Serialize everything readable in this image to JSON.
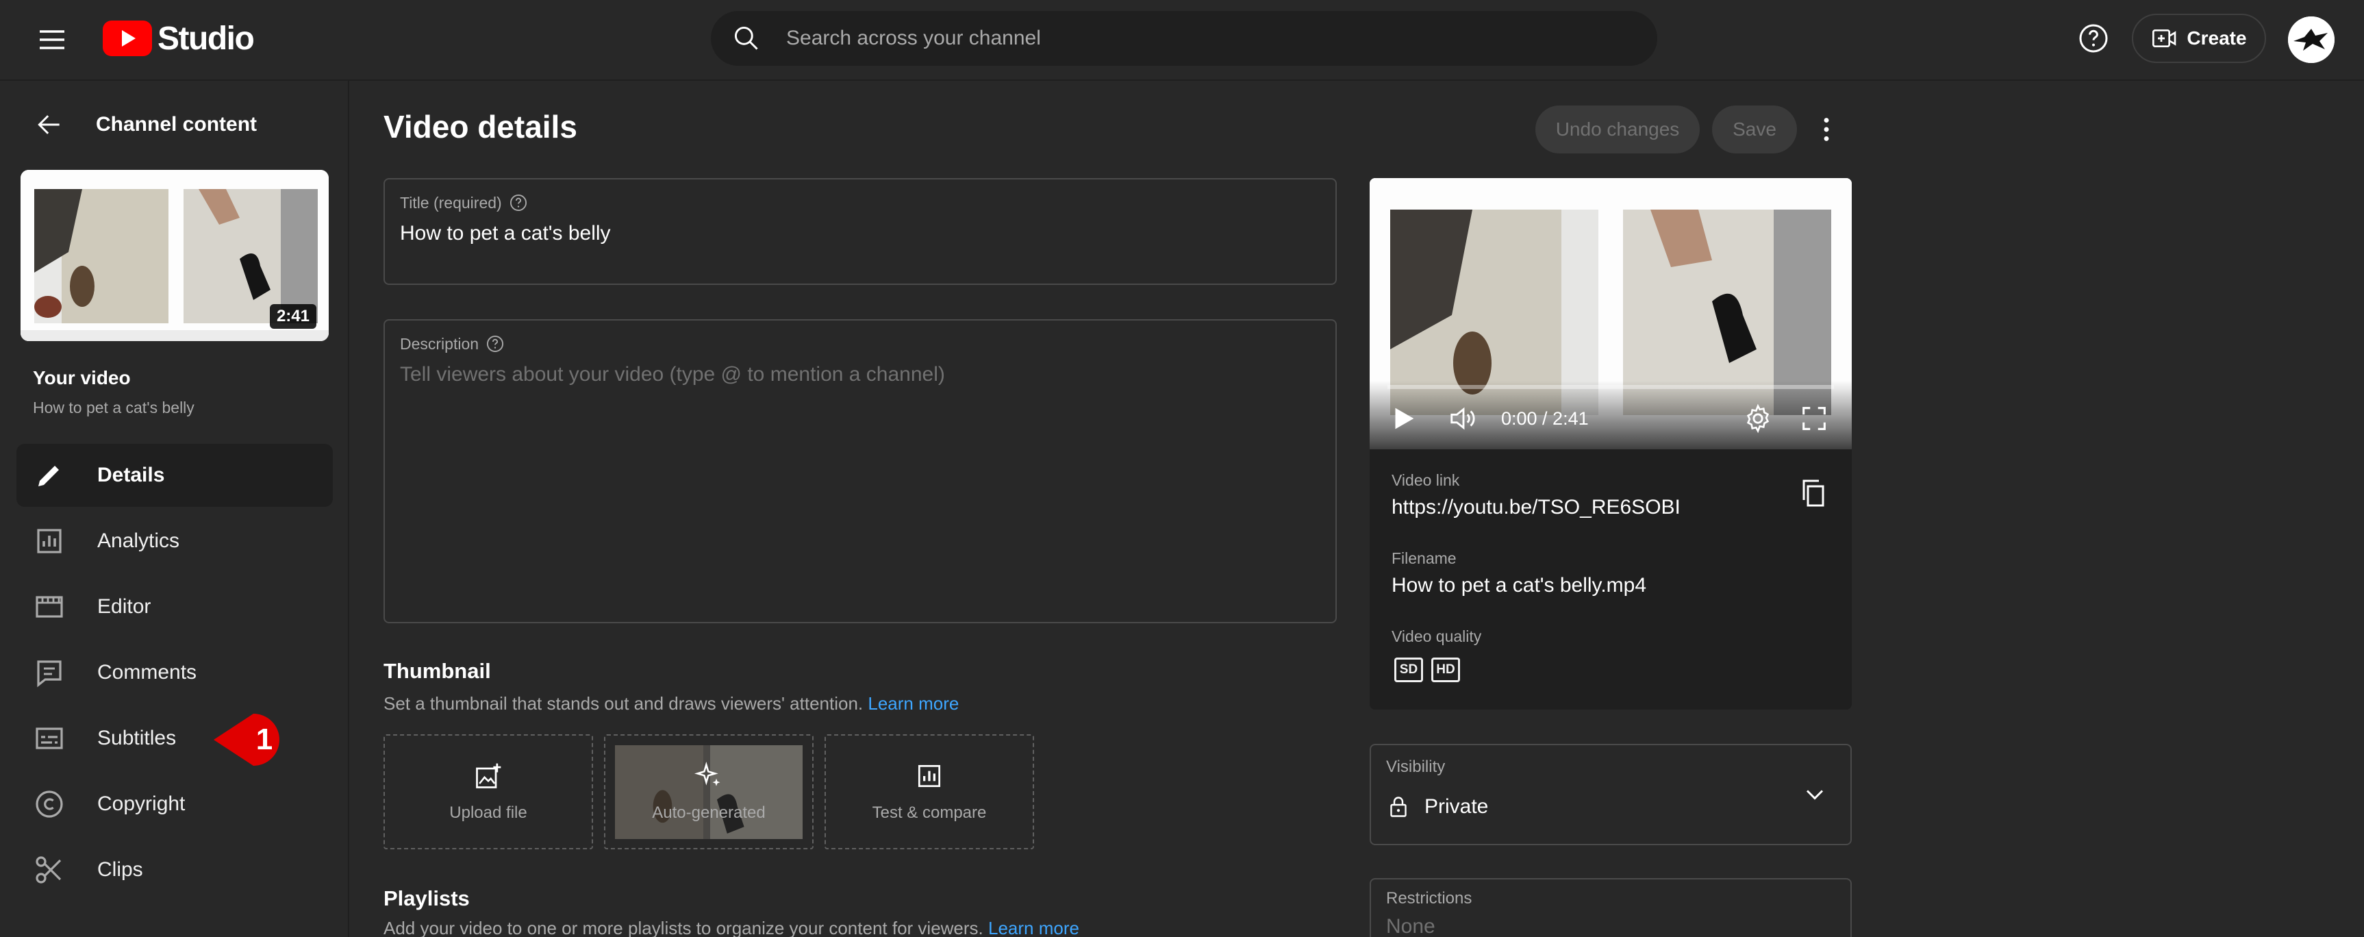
{
  "header": {
    "logo_text": "Studio",
    "search_placeholder": "Search across your channel",
    "create_label": "Create"
  },
  "sidebar": {
    "back_title": "Channel content",
    "thumb_duration": "2:41",
    "your_video_label": "Your video",
    "your_video_title": "How to pet a cat's belly",
    "items": [
      {
        "label": "Details",
        "icon": "pencil-icon",
        "active": true
      },
      {
        "label": "Analytics",
        "icon": "analytics-icon"
      },
      {
        "label": "Editor",
        "icon": "editor-icon"
      },
      {
        "label": "Comments",
        "icon": "comments-icon"
      },
      {
        "label": "Subtitles",
        "icon": "subtitles-icon"
      },
      {
        "label": "Copyright",
        "icon": "copyright-icon"
      },
      {
        "label": "Clips",
        "icon": "scissors-icon"
      }
    ],
    "step_marker": "1"
  },
  "main": {
    "title": "Video details",
    "undo_label": "Undo changes",
    "save_label": "Save",
    "title_field": {
      "label": "Title (required)",
      "value": "How to pet a cat's belly"
    },
    "description_field": {
      "label": "Description",
      "placeholder": "Tell viewers about your video (type @ to mention a channel)"
    },
    "thumbnail": {
      "title": "Thumbnail",
      "desc": "Set a thumbnail that stands out and draws viewers' attention.",
      "learn_more": "Learn more",
      "options": [
        "Upload file",
        "Auto-generated",
        "Test & compare"
      ]
    },
    "playlists": {
      "title": "Playlists",
      "desc": "Add your video to one or more playlists to organize your content for viewers.",
      "learn_more": "Learn more"
    }
  },
  "player": {
    "time": "0:00 / 2:41",
    "video_link_label": "Video link",
    "video_link": "https://youtu.be/TSO_RE6SOBI",
    "filename_label": "Filename",
    "filename": "How to pet a cat's belly.mp4",
    "quality_label": "Video quality",
    "quality_badges": [
      "SD",
      "HD"
    ]
  },
  "visibility": {
    "label": "Visibility",
    "value": "Private"
  },
  "restrictions": {
    "label": "Restrictions",
    "value": "None"
  },
  "colors": {
    "background": "#282828",
    "accent": "#3ea6ff",
    "brand": "#ff0000",
    "marker": "#e00000"
  }
}
